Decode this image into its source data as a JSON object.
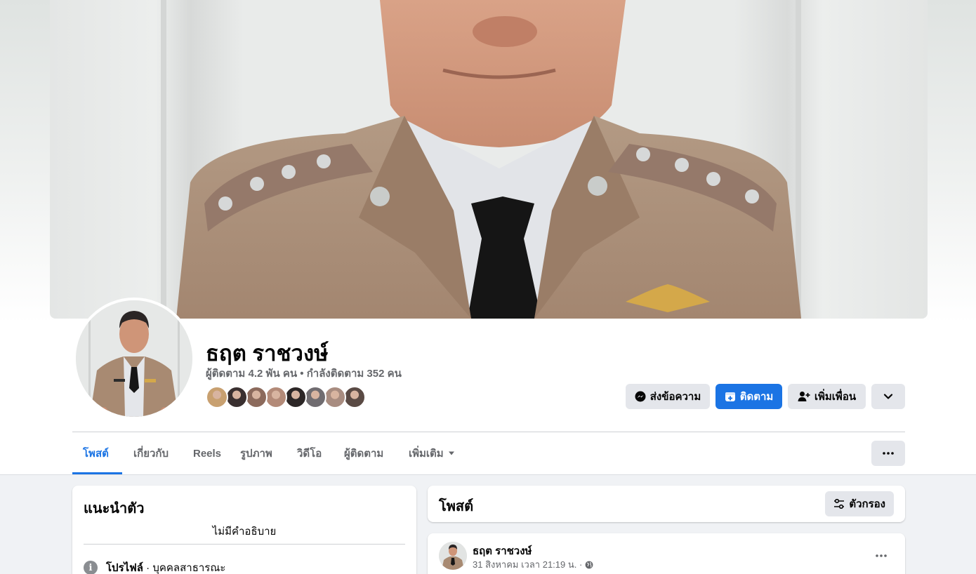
{
  "profile": {
    "name": "ธฤต ราชวงษ์",
    "followers_text": "ผู้ติดตาม 4.2 พัน คน • กำลังติดตาม 352 คน",
    "mutual_friends": [
      {
        "color": "#c8a070"
      },
      {
        "color": "#3a3030"
      },
      {
        "color": "#8c6a5c"
      },
      {
        "color": "#b38a78"
      },
      {
        "color": "#2c2626"
      },
      {
        "color": "#706c70"
      },
      {
        "color": "#a88c80"
      },
      {
        "color": "#5a4a44"
      }
    ]
  },
  "actions": {
    "message_label": "ส่งข้อความ",
    "follow_label": "ติดตาม",
    "add_friend_label": "เพิ่มเพื่อน"
  },
  "tabs": [
    {
      "label": "โพสต์",
      "active": true
    },
    {
      "label": "เกี่ยวกับ"
    },
    {
      "label": "Reels"
    },
    {
      "label": "รูปภาพ"
    },
    {
      "label": "วิดีโอ"
    },
    {
      "label": "ผู้ติดตาม"
    },
    {
      "label": "เพิ่มเติม"
    }
  ],
  "intro": {
    "title": "แนะนำตัว",
    "bio": "ไม่มีคำอธิบาย",
    "profile_label": "โปรไฟล์",
    "profile_type": " · บุคคลสาธารณะ"
  },
  "posts": {
    "title": "โพสต์",
    "filter_label": "ตัวกรอง"
  },
  "post": {
    "author": "ธฤต ราชวงษ์",
    "timestamp": "31 สิงหาคม เวลา 21:19 น. ·"
  },
  "colors": {
    "accent": "#1b74e4",
    "uniform": "#a88a72",
    "secondary_text": "#65676b"
  }
}
